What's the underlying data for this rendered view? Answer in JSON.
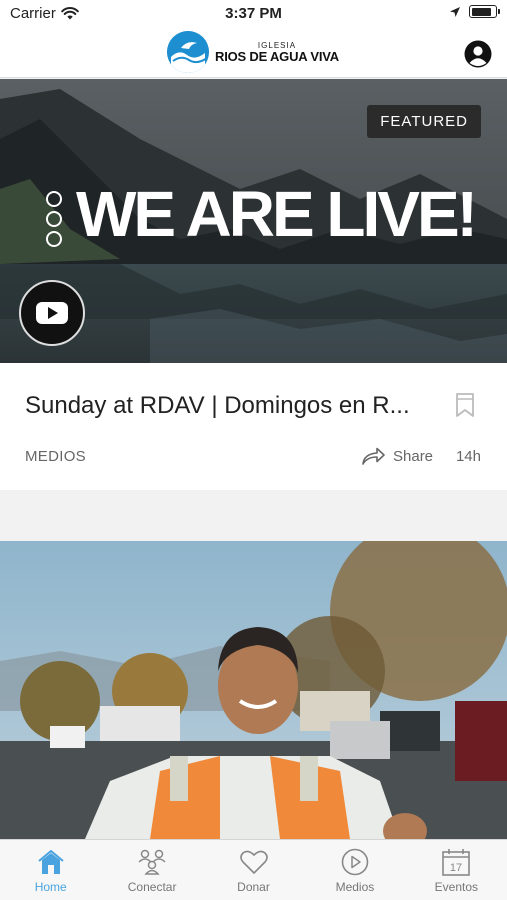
{
  "status_bar": {
    "carrier": "Carrier",
    "time": "3:37 PM",
    "battery_level": 0.9
  },
  "header": {
    "logo_small": "IGLESIA",
    "logo_big": "RIOS DE AGUA VIVA"
  },
  "featured_post": {
    "badge": "FEATURED",
    "headline": "WE ARE LIVE!",
    "title": "Sunday at RDAV | Domingos en R...",
    "category": "MEDIOS",
    "share_label": "Share",
    "time_ago": "14h"
  },
  "tabs": [
    {
      "label": "Home",
      "icon": "home-icon",
      "active": true
    },
    {
      "label": "Conectar",
      "icon": "people-icon",
      "active": false
    },
    {
      "label": "Donar",
      "icon": "heart-icon",
      "active": false
    },
    {
      "label": "Medios",
      "icon": "play-circle-icon",
      "active": false
    },
    {
      "label": "Eventos",
      "icon": "calendar-icon",
      "active": false
    }
  ],
  "calendar_day": "17",
  "colors": {
    "accent": "#4aa3df",
    "brand": "#1d8fd1"
  }
}
